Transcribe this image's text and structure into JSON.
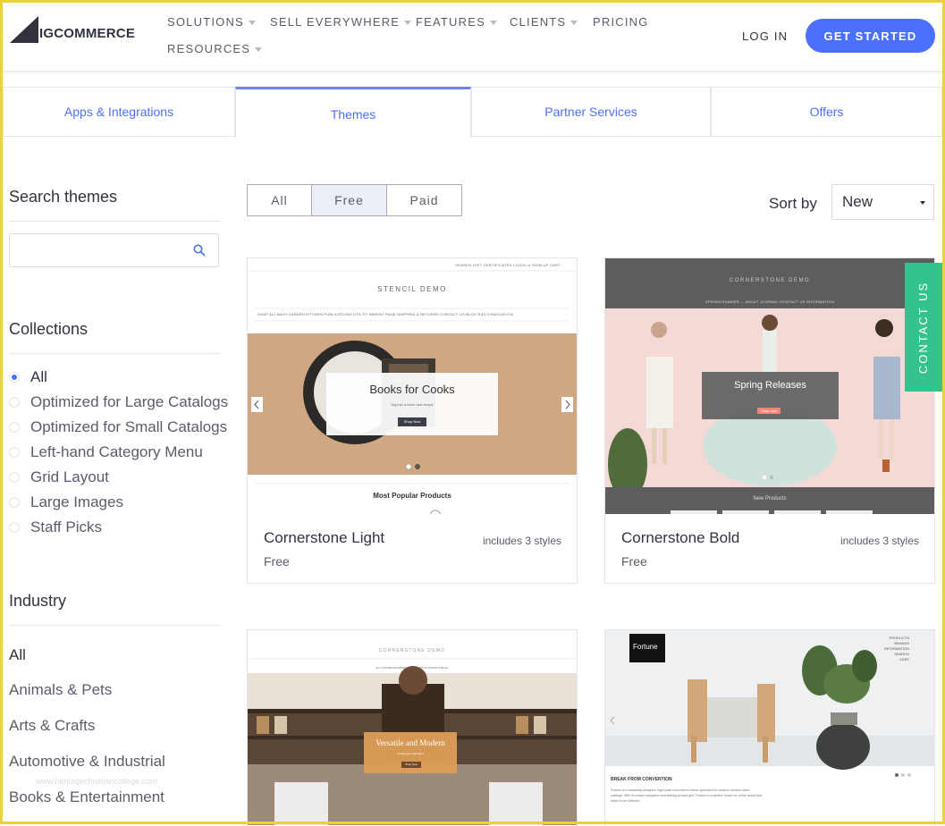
{
  "brand": {
    "logo_text": "BIGCOMMERCE"
  },
  "nav": {
    "items": [
      {
        "label": "SOLUTIONS",
        "dropdown": true
      },
      {
        "label": "SELL EVERYWHERE",
        "dropdown": true
      },
      {
        "label": "FEATURES",
        "dropdown": true
      },
      {
        "label": "CLIENTS",
        "dropdown": true
      },
      {
        "label": "PRICING",
        "dropdown": false
      },
      {
        "label": "RESOURCES",
        "dropdown": true
      }
    ],
    "login": "LOG IN",
    "cta": "GET STARTED"
  },
  "tabs": [
    {
      "label": "Apps & Integrations",
      "active": false
    },
    {
      "label": "Themes",
      "active": true
    },
    {
      "label": "Partner Services",
      "active": false
    },
    {
      "label": "Offers",
      "active": false
    }
  ],
  "sidebar": {
    "search_heading": "Search themes",
    "search_placeholder": "",
    "collections_heading": "Collections",
    "collections": [
      {
        "label": "All",
        "selected": true
      },
      {
        "label": "Optimized for Large Catalogs",
        "selected": false
      },
      {
        "label": "Optimized for Small Catalogs",
        "selected": false
      },
      {
        "label": "Left-hand Category Menu",
        "selected": false
      },
      {
        "label": "Grid Layout",
        "selected": false
      },
      {
        "label": "Large Images",
        "selected": false
      },
      {
        "label": "Staff Picks",
        "selected": false
      }
    ],
    "industry_heading": "Industry",
    "industries": [
      "All",
      "Animals & Pets",
      "Arts & Crafts",
      "Automotive & Industrial",
      "Books & Entertainment"
    ]
  },
  "filters": {
    "options": [
      "All",
      "Free",
      "Paid"
    ],
    "selected": "Free",
    "sort_label": "Sort by",
    "sort_value": "New"
  },
  "themes": [
    {
      "name": "Cornerstone Light",
      "price": "Free",
      "styles": "includes 3 styles",
      "preview": {
        "store": "STENCIL DEMO",
        "util": "SEARCH   GIFT CERTIFICATES   LOGIN  or  SIGN UP   CART",
        "menu": "SHOP ALL   BATH   GARDEN   KITCHEN   PUBLICATIONS   UTILITY   PARENT PAGE   SHIPPING & RETURNS   CONTACT US   BLOG   RSS SYNDICATION",
        "banner_title": "Books for Cooks",
        "banner_sub": "Dig into a fresh new recipe",
        "banner_btn": "Shop Now",
        "section": "Most Popular Products"
      }
    },
    {
      "name": "Cornerstone Bold",
      "price": "Free",
      "styles": "includes 3 styles",
      "preview": {
        "store": "CORNERSTONE DEMO",
        "menu": "SPRING/SUMMER ⌄    ABOUT    JOURNAL    CONTACT US    INFORMATION",
        "banner_title": "Spring Releases",
        "banner_btn": "Shop now",
        "section": "New Products"
      }
    },
    {
      "preview": {
        "store": "CORNERSTONE DEMO",
        "menu": "ALL COFFEE   EQUIPMENT   T-TEA   ABOUT   CONTACT   BLOG",
        "banner_title": "Versatile and Modern",
        "banner_sub": "Create your own store",
        "banner_btn": "Shop Now"
      }
    },
    {
      "preview": {
        "store": "Fortune",
        "menu_items": [
          "PRODUCTS",
          "BRANDS",
          "INFORMATION",
          "SEARCH",
          "CART"
        ],
        "section_title": "BREAK FROM CONVENTION",
        "section_text": "Fortune is a beautifully designed, high-scale ecommerce theme optimized for small-to-medium-sized catalogs. With its unique navigation and striking product grid, Fortune is a perfect choice for online stores that desire to be different."
      }
    }
  ],
  "contact_tab": "CONTACT US",
  "watermark": "www.heritagechristiancollege.com"
}
